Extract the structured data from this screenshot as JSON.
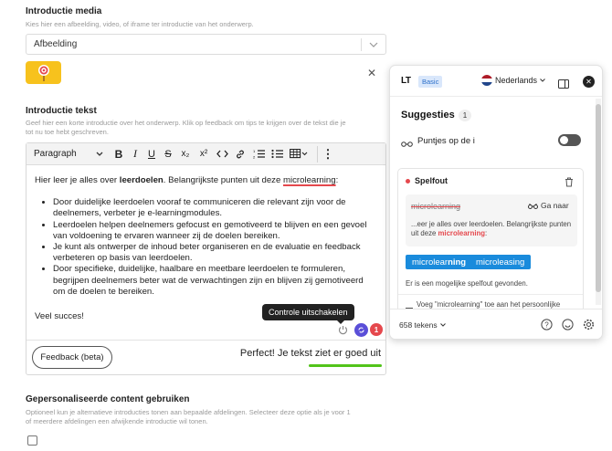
{
  "intro_media": {
    "label": "Introductie media",
    "helper": "Kies hier een afbeelding, video, of iframe ter introductie van het onderwerp.",
    "select_value": "Afbeelding",
    "chevron": "chevron-down-icon",
    "remove": "✕"
  },
  "intro_text": {
    "label": "Introductie tekst",
    "helper_line1": "Geef hier een korte introductie over het onderwerp. Klik op feedback om tips te krijgen over de tekst die je",
    "helper_line2": "tot nu toe hebt geschreven."
  },
  "toolbar": {
    "paragraph": "Paragraph",
    "bold": "B",
    "italic": "I",
    "underline": "U",
    "strike": "S",
    "subscript": "x₂",
    "superscript": "x²",
    "more": "⋮"
  },
  "editor": {
    "intro_before": "Hier leer je alles over ",
    "intro_bold": "leerdoelen",
    "intro_middle": ". Belangrijkste punten uit deze ",
    "intro_error": "microlearning",
    "intro_end": ":",
    "bullets": [
      "Door duidelijke leerdoelen vooraf te communiceren die relevant zijn voor de deelnemers, verbeter je e-learningmodules.",
      "Leerdoelen helpen deelnemers gefocust en gemotiveerd te blijven en een gevoel van voldoening te ervaren wanneer zij de doelen bereiken.",
      "Je kunt als ontwerper de inhoud beter organiseren en de evaluatie en feedback verbeteren op basis van leerdoelen.",
      "Door specifieke, duidelijke, haalbare en meetbare leerdoelen te formuleren, begrijpen deelnemers beter wat de verwachtingen zijn en blijven zij gemotiveerd om de doelen te bereiken."
    ],
    "closing": "Veel succes!",
    "tooltip": "Controle uitschakelen",
    "badge_count": "1"
  },
  "feedback": {
    "button": "Feedback (beta)",
    "status": "Perfect! Je tekst ziet er goed uit",
    "score_fraction": 1.0
  },
  "personalised": {
    "label": "Gepersonaliseerde content gebruiken",
    "helper_line1": "Optioneel kun je alternatieve introducties tonen aan bepaalde afdelingen. Selecteer deze optie als je voor 1",
    "helper_line2": "of meerdere afdelingen een afwijkende introductie wil tonen."
  },
  "lt_panel": {
    "logo": "LT",
    "plan": "Basic",
    "language": "Nederlands",
    "suggestions_title": "Suggesties",
    "suggestions_count": "1",
    "dots_label": "Puntjes op de i",
    "error_type": "Spelfout",
    "error_word": "microlearning",
    "goto": "Ga naar",
    "context_before": "...eer je alles over leerdoelen. Belangrijkste punten uit deze ",
    "context_word": "microlearning",
    "context_end": ":",
    "options": [
      "microlearning",
      "microleasing"
    ],
    "option_bold_part": "ning",
    "note": "Er is een mogelijke spelfout gevonden.",
    "add_dict": "Voeg \"microlearning\" toe aan het persoonlijke",
    "token_count": "658 tekens",
    "colors": {
      "accent": "#1a8bdc",
      "error": "#e5484d",
      "ok": "#52c41a"
    }
  }
}
